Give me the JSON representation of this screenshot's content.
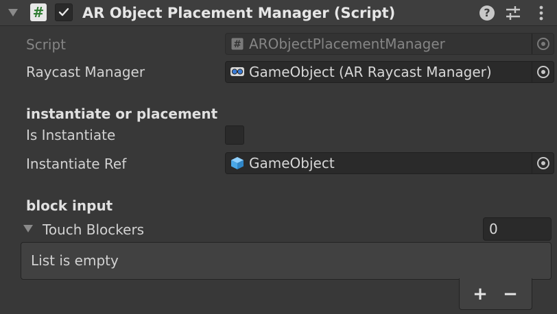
{
  "component": {
    "title": "AR Object Placement Manager (Script)",
    "script_icon_glyph": "#",
    "enabled": true,
    "help_glyph": "?"
  },
  "properties": {
    "script": {
      "label": "Script",
      "value": "ARObjectPlacementManager"
    },
    "raycast_manager": {
      "label": "Raycast Manager",
      "value": "GameObject (AR Raycast Manager)"
    },
    "section_instantiate": "instantiate or placement",
    "is_instantiate": {
      "label": "Is Instantiate",
      "checked": false
    },
    "instantiate_ref": {
      "label": "Instantiate Ref",
      "value": "GameObject"
    },
    "section_block": "block input",
    "touch_blockers": {
      "label": "Touch Blockers",
      "size": "0",
      "empty_text": "List is empty"
    }
  },
  "list_buttons": {
    "add": "+",
    "remove": "−"
  },
  "colors": {
    "background": "#383838",
    "header": "#3e3e3e",
    "field": "#2a2a2a",
    "script_green": "#2f7d32",
    "prefab_blue": "#4aa8e8"
  }
}
